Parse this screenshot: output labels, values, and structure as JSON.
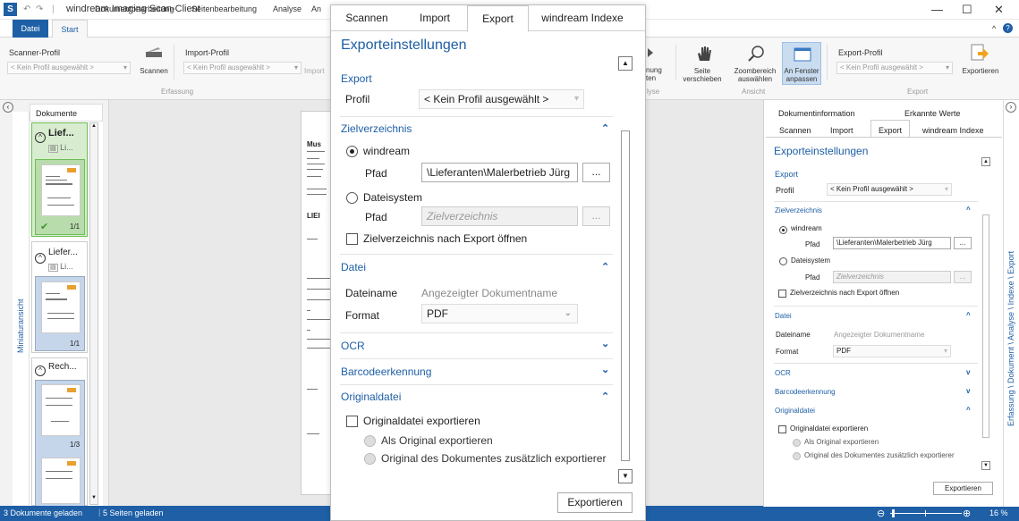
{
  "window": {
    "title": "windream Imaging Scan-Client",
    "minimize": "—",
    "maximize": "☐",
    "close": "✕",
    "help": "?"
  },
  "ribbon_tabs": [
    "Datei",
    "Start",
    "Dokumentbearbeitung",
    "Seitenbearbeitung",
    "Analyse",
    "An"
  ],
  "ribbon": {
    "scanner_profil_label": "Scanner-Profil",
    "scanner_profil_value": "< Kein Profil ausgewählt >",
    "scannen": "Scannen",
    "import_profil_label": "Import-Profil",
    "import_profil_value": "< Kein Profil ausgewählt >",
    "import_btn": "Import",
    "erfassung_group": "Erfassung",
    "nung": "nung",
    "ten": "ten",
    "lyse": "lyse",
    "seite_verschieben": "Seite verschieben",
    "zoombereich": "Zoombereich auswählen",
    "an_fenster": "An Fenster anpassen",
    "ansicht_group": "Ansicht",
    "export_profil_label": "Export-Profil",
    "export_profil_value": "< Kein Profil ausgewählt >",
    "exportieren": "Exportieren",
    "export_group": "Export"
  },
  "left_panel": {
    "vertical_label": "Miniaturansicht",
    "tab": "Dokumente",
    "docs": [
      {
        "title": "Lief...",
        "sub": "Li...",
        "count": "1/1"
      },
      {
        "title": "Liefer...",
        "sub": "Li...",
        "count": "1/1"
      },
      {
        "title": "Rech...",
        "sub": "",
        "count": "1/3"
      }
    ]
  },
  "status": {
    "docs": "3 Dokumente geladen",
    "pages": "5 Seiten geladen",
    "zoom": "16 %"
  },
  "document_preview": {
    "lines": [
      "Mus",
      "LIEI"
    ]
  },
  "dialog": {
    "tabs": [
      "Scannen",
      "Import",
      "Export",
      "windream Indexe"
    ],
    "active_tab": "Export",
    "heading": "Exporteinstellungen",
    "export_section": "Export",
    "profil_label": "Profil",
    "profil_value": "< Kein Profil ausgewählt >",
    "zielverzeichnis_section": "Zielverzeichnis",
    "windream_option": "windream",
    "pfad_label": "Pfad",
    "pfad_value": "\\Lieferanten\\Malerbetrieb Jürg",
    "browse": "...",
    "dateisystem_option": "Dateisystem",
    "pfad2_label": "Pfad",
    "pfad2_placeholder": "Zielverzeichnis",
    "open_after_export": "Zielverzeichnis nach Export öffnen",
    "datei_section": "Datei",
    "dateiname_label": "Dateiname",
    "dateiname_value": "Angezeigter Dokumentname",
    "format_label": "Format",
    "format_value": "PDF",
    "ocr_section": "OCR",
    "barcode_section": "Barcodeerkennung",
    "originaldatei_section": "Originaldatei",
    "originaldatei_export": "Originaldatei exportieren",
    "als_original": "Als Original exportieren",
    "original_zusaetzlich": "Original des Dokumentes zusätzlich exportierer",
    "export_button": "Exportieren"
  },
  "right_panel": {
    "top_tabs": [
      "Dokumentinformation",
      "Erkannte Werte"
    ],
    "tabs": [
      "Scannen",
      "Import",
      "Export",
      "windream Indexe"
    ],
    "vertical_label": "Erfassung \\ Dokument \\ Analyse \\ Indexe \\ Export"
  },
  "colors": {
    "accent": "#1e5fa6"
  }
}
